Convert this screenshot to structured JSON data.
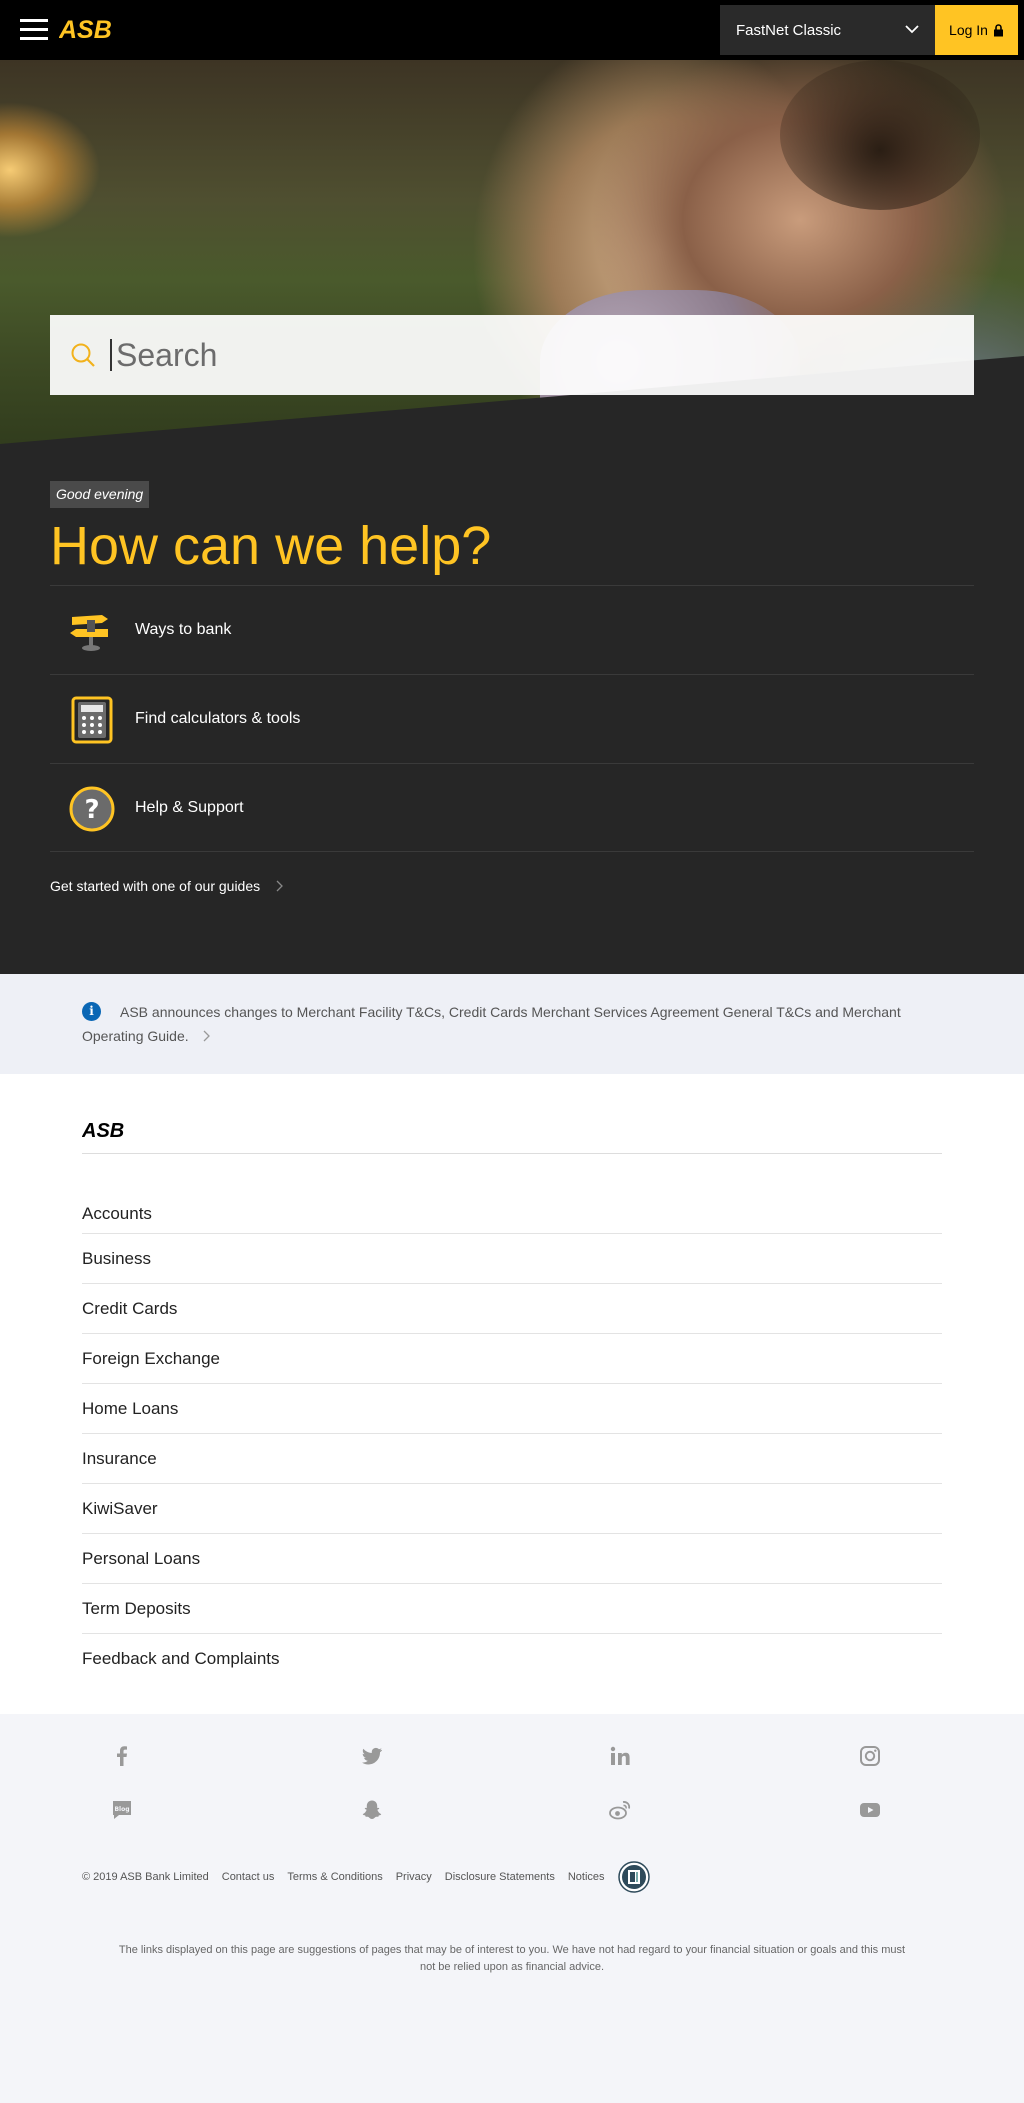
{
  "header": {
    "logo_text": "ASB",
    "fastnet_label": "FastNet Classic",
    "login_label": "Log In"
  },
  "hero": {
    "search_placeholder": "Search"
  },
  "help": {
    "greeting": "Good evening",
    "title": "How can we help?",
    "items": [
      {
        "label": "Ways to bank",
        "icon": "signpost-icon"
      },
      {
        "label": "Find calculators & tools",
        "icon": "calculator-icon"
      },
      {
        "label": "Help & Support",
        "icon": "question-mark-icon"
      }
    ],
    "guides_link": "Get started with one of our guides"
  },
  "notice": {
    "text": "ASB announces changes to Merchant Facility T&Cs, Credit Cards Merchant Services Agreement General T&Cs and Merchant Operating Guide."
  },
  "footer_nav": {
    "logo_text": "ASB",
    "links": [
      "Accounts",
      "Business",
      "Credit Cards",
      "Foreign Exchange",
      "Home Loans",
      "Insurance",
      "KiwiSaver",
      "Personal Loans",
      "Term Deposits",
      "Feedback and Complaints"
    ]
  },
  "social": {
    "icons": [
      "facebook-icon",
      "twitter-icon",
      "linkedin-icon",
      "instagram-icon",
      "blog-icon",
      "snapchat-icon",
      "weibo-icon",
      "youtube-icon"
    ]
  },
  "legal": {
    "copyright": "© 2019 ASB Bank Limited",
    "links": [
      "Contact us",
      "Terms & Conditions",
      "Privacy",
      "Disclosure Statements",
      "Notices"
    ]
  },
  "disclaimer": "The links displayed on this page are suggestions of pages that may be of interest to you. We have not had regard to your financial situation or goals and this must not be relied upon as financial advice.",
  "colors": {
    "brand_yellow": "#ffc423",
    "header_bg": "#000000",
    "help_bg": "#262626",
    "info_blue": "#0a67b5"
  }
}
